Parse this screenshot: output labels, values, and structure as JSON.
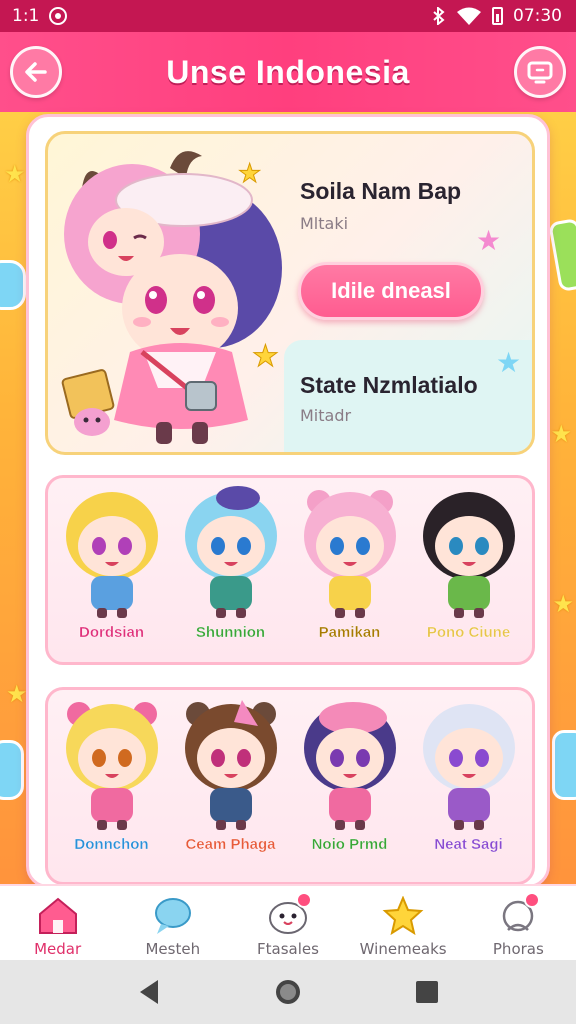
{
  "status_bar": {
    "time_left": "1:1",
    "time_right": "07:30",
    "icons": [
      "alarm-icon",
      "bluetooth-icon",
      "wifi-icon",
      "battery-icon"
    ]
  },
  "header": {
    "title": "Unse Indonesia",
    "back_icon": "back-arrow-icon",
    "menu_icon": "screen-icon"
  },
  "featured": {
    "title_1": "Soila Nam Bap",
    "subtitle_1": "Mltaki",
    "button_label": "Idile dneasl",
    "title_2": "State Nzmlatialo",
    "subtitle_2": "Mitadr"
  },
  "characters_row_1": [
    {
      "name": "Dordsian",
      "color": "#e0307a"
    },
    {
      "name": "Shunnion",
      "color": "#3aa536"
    },
    {
      "name": "Pamikan",
      "color": "#a87a00"
    },
    {
      "name": "Pono Ciune",
      "color": "#e8c44a"
    }
  ],
  "characters_row_2": [
    {
      "name": "Donnchon",
      "color": "#2a8fd8"
    },
    {
      "name": "Ceam Phaga",
      "color": "#e85a3a"
    },
    {
      "name": "Noio Prmd",
      "color": "#3aa536"
    },
    {
      "name": "Neat Sagi",
      "color": "#8a4ad0"
    }
  ],
  "bottom_nav": [
    {
      "label": "Medar",
      "icon": "home-icon",
      "active": true
    },
    {
      "label": "Mesteh",
      "icon": "chat-bubble-icon",
      "active": false
    },
    {
      "label": "Ftasales",
      "icon": "mascot-icon",
      "active": false,
      "badge": true
    },
    {
      "label": "Winemeaks",
      "icon": "star-icon",
      "active": false
    },
    {
      "label": "Phoras",
      "icon": "profile-icon",
      "active": false,
      "badge": true
    }
  ],
  "system_nav": {
    "icons": [
      "back-triangle-icon",
      "home-circle-icon",
      "recents-square-icon"
    ]
  },
  "colors": {
    "accent": "#ff4f8b",
    "status_bar": "#c41752",
    "background": "#ffb43a"
  }
}
